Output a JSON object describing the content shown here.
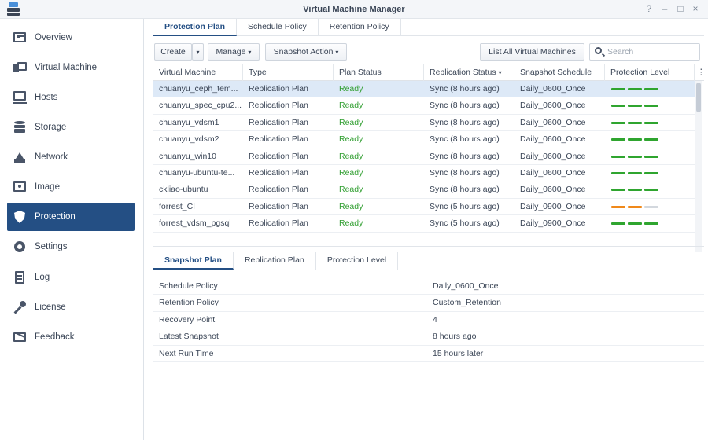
{
  "window": {
    "title": "Virtual Machine Manager",
    "controls": [
      "?",
      "–",
      "□",
      "×"
    ]
  },
  "sidebar": {
    "items": [
      {
        "label": "Overview",
        "icon": "overview-icon"
      },
      {
        "label": "Virtual Machine",
        "icon": "virtual-machine-icon"
      },
      {
        "label": "Hosts",
        "icon": "hosts-icon"
      },
      {
        "label": "Storage",
        "icon": "storage-icon"
      },
      {
        "label": "Network",
        "icon": "network-icon"
      },
      {
        "label": "Image",
        "icon": "image-icon"
      },
      {
        "label": "Protection",
        "icon": "protection-icon",
        "active": true
      },
      {
        "label": "Settings",
        "icon": "settings-icon"
      },
      {
        "label": "Log",
        "icon": "log-icon"
      },
      {
        "label": "License",
        "icon": "license-icon"
      },
      {
        "label": "Feedback",
        "icon": "feedback-icon"
      }
    ]
  },
  "tabs": [
    "Protection Plan",
    "Schedule Policy",
    "Retention Policy"
  ],
  "toolbar": {
    "create": "Create",
    "manage": "Manage",
    "snapshot_action": "Snapshot Action",
    "list_all": "List All Virtual Machines",
    "search_placeholder": "Search"
  },
  "table": {
    "columns": [
      "Virtual Machine",
      "Type",
      "Plan Status",
      "Replication Status",
      "Snapshot Schedule",
      "Protection Level"
    ],
    "sort_column": "Replication Status",
    "rows": [
      {
        "vm": "chuanyu_ceph_tem...",
        "type": "Replication Plan",
        "status": "Ready",
        "replication": "Sync (8 hours ago)",
        "schedule": "Daily_0600_Once",
        "level": "full"
      },
      {
        "vm": "chuanyu_spec_cpu2...",
        "type": "Replication Plan",
        "status": "Ready",
        "replication": "Sync (8 hours ago)",
        "schedule": "Daily_0600_Once",
        "level": "full"
      },
      {
        "vm": "chuanyu_vdsm1",
        "type": "Replication Plan",
        "status": "Ready",
        "replication": "Sync (8 hours ago)",
        "schedule": "Daily_0600_Once",
        "level": "full"
      },
      {
        "vm": "chuanyu_vdsm2",
        "type": "Replication Plan",
        "status": "Ready",
        "replication": "Sync (8 hours ago)",
        "schedule": "Daily_0600_Once",
        "level": "full"
      },
      {
        "vm": "chuanyu_win10",
        "type": "Replication Plan",
        "status": "Ready",
        "replication": "Sync (8 hours ago)",
        "schedule": "Daily_0600_Once",
        "level": "full"
      },
      {
        "vm": "chuanyu-ubuntu-te...",
        "type": "Replication Plan",
        "status": "Ready",
        "replication": "Sync (8 hours ago)",
        "schedule": "Daily_0600_Once",
        "level": "full"
      },
      {
        "vm": "ckliao-ubuntu",
        "type": "Replication Plan",
        "status": "Ready",
        "replication": "Sync (8 hours ago)",
        "schedule": "Daily_0600_Once",
        "level": "full"
      },
      {
        "vm": "forrest_CI",
        "type": "Replication Plan",
        "status": "Ready",
        "replication": "Sync (5 hours ago)",
        "schedule": "Daily_0900_Once",
        "level": "partial"
      },
      {
        "vm": "forrest_vdsm_pgsql",
        "type": "Replication Plan",
        "status": "Ready",
        "replication": "Sync (5 hours ago)",
        "schedule": "Daily_0900_Once",
        "level": "full"
      }
    ]
  },
  "detail": {
    "tabs": [
      "Snapshot Plan",
      "Replication Plan",
      "Protection Level"
    ],
    "rows": [
      {
        "label": "Schedule Policy",
        "value": "Daily_0600_Once"
      },
      {
        "label": "Retention Policy",
        "value": "Custom_Retention"
      },
      {
        "label": "Recovery Point",
        "value": "4"
      },
      {
        "label": "Latest Snapshot",
        "value": "8 hours ago"
      },
      {
        "label": "Next Run Time",
        "value": "15 hours later"
      }
    ]
  },
  "colors": {
    "accent": "#244f84",
    "ready": "#2f9e2f",
    "level_full": "#2fa52f",
    "level_partial": "#f0891a",
    "level_empty": "#d3d8de"
  }
}
